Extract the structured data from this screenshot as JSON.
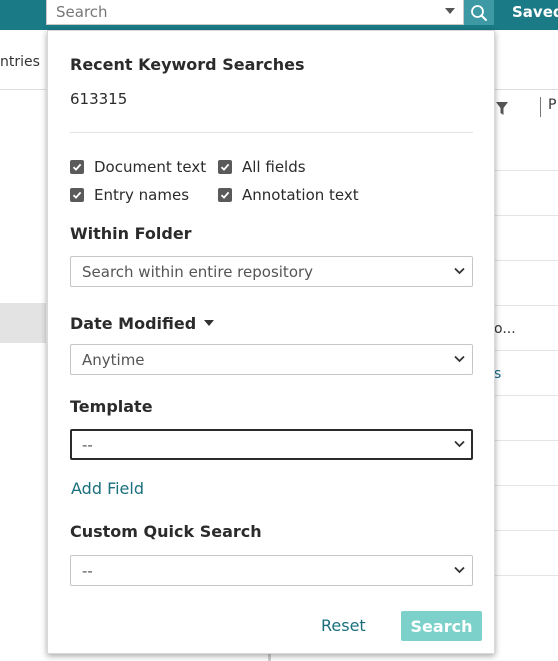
{
  "topbar": {
    "search_placeholder": "Search",
    "saved_label": "Saved"
  },
  "background": {
    "left_tab_label": "ntries",
    "column_header": "P",
    "row_text_1": "o...",
    "row_text_2": "s"
  },
  "panel": {
    "recent_heading": "Recent Keyword Searches",
    "recent_items": [
      "613315"
    ],
    "checkboxes": [
      {
        "label": "Document text",
        "checked": true
      },
      {
        "label": "All fields",
        "checked": true
      },
      {
        "label": "Entry names",
        "checked": true
      },
      {
        "label": "Annotation text",
        "checked": true
      }
    ],
    "within_folder": {
      "label": "Within Folder",
      "value": "Search within entire repository"
    },
    "date_modified": {
      "label": "Date Modified",
      "value": "Anytime"
    },
    "template": {
      "label": "Template",
      "value": "--"
    },
    "add_field_label": "Add Field",
    "custom_quick_search": {
      "label": "Custom Quick Search",
      "value": "--"
    },
    "reset_label": "Reset",
    "search_label": "Search"
  },
  "colors": {
    "topbar": "#1a7b86",
    "accent_link": "#1a6f7d",
    "search_button": "#7dd1cb"
  },
  "icons": [
    "search-icon",
    "caret-down-icon",
    "filter-icon",
    "checkmark-icon",
    "chevron-down-icon"
  ]
}
